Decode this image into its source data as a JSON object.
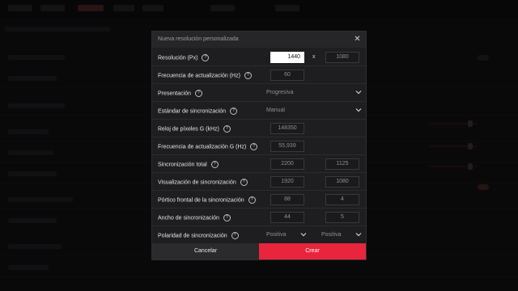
{
  "dialog": {
    "title": "Nueva resolución personalizada",
    "rows": [
      {
        "label": "Resolución (Px)",
        "value1": "1440",
        "sep": "x",
        "value2": "1080"
      },
      {
        "label": "Frecuencia de actualización (Hz)",
        "value1": "60"
      },
      {
        "label": "Presentación",
        "select": "Progresiva"
      },
      {
        "label": "Estándar de sincronización",
        "select": "Manual"
      },
      {
        "label": "Reloj de píxeles G (kHz)",
        "value1": "148350"
      },
      {
        "label": "Frecuencia de actualización G (Hz)",
        "value1": "55,939"
      },
      {
        "label": "Sincronización total",
        "value1": "2200",
        "value2": "1125"
      },
      {
        "label": "Visualización de sincronización",
        "value1": "1920",
        "value2": "1080"
      },
      {
        "label": "Pórtico frontal de la sincronización",
        "value1": "88",
        "value2": "4"
      },
      {
        "label": "Ancho de sincronización",
        "value1": "44",
        "value2": "5"
      },
      {
        "label": "Polaridad de sincronización",
        "select": "Positiva",
        "select2": "Positiva"
      }
    ],
    "cancel_label": "Cancelar",
    "create_label": "Crear"
  },
  "colors": {
    "accent": "#e8253d",
    "dialog_bg": "#1e1e20"
  }
}
